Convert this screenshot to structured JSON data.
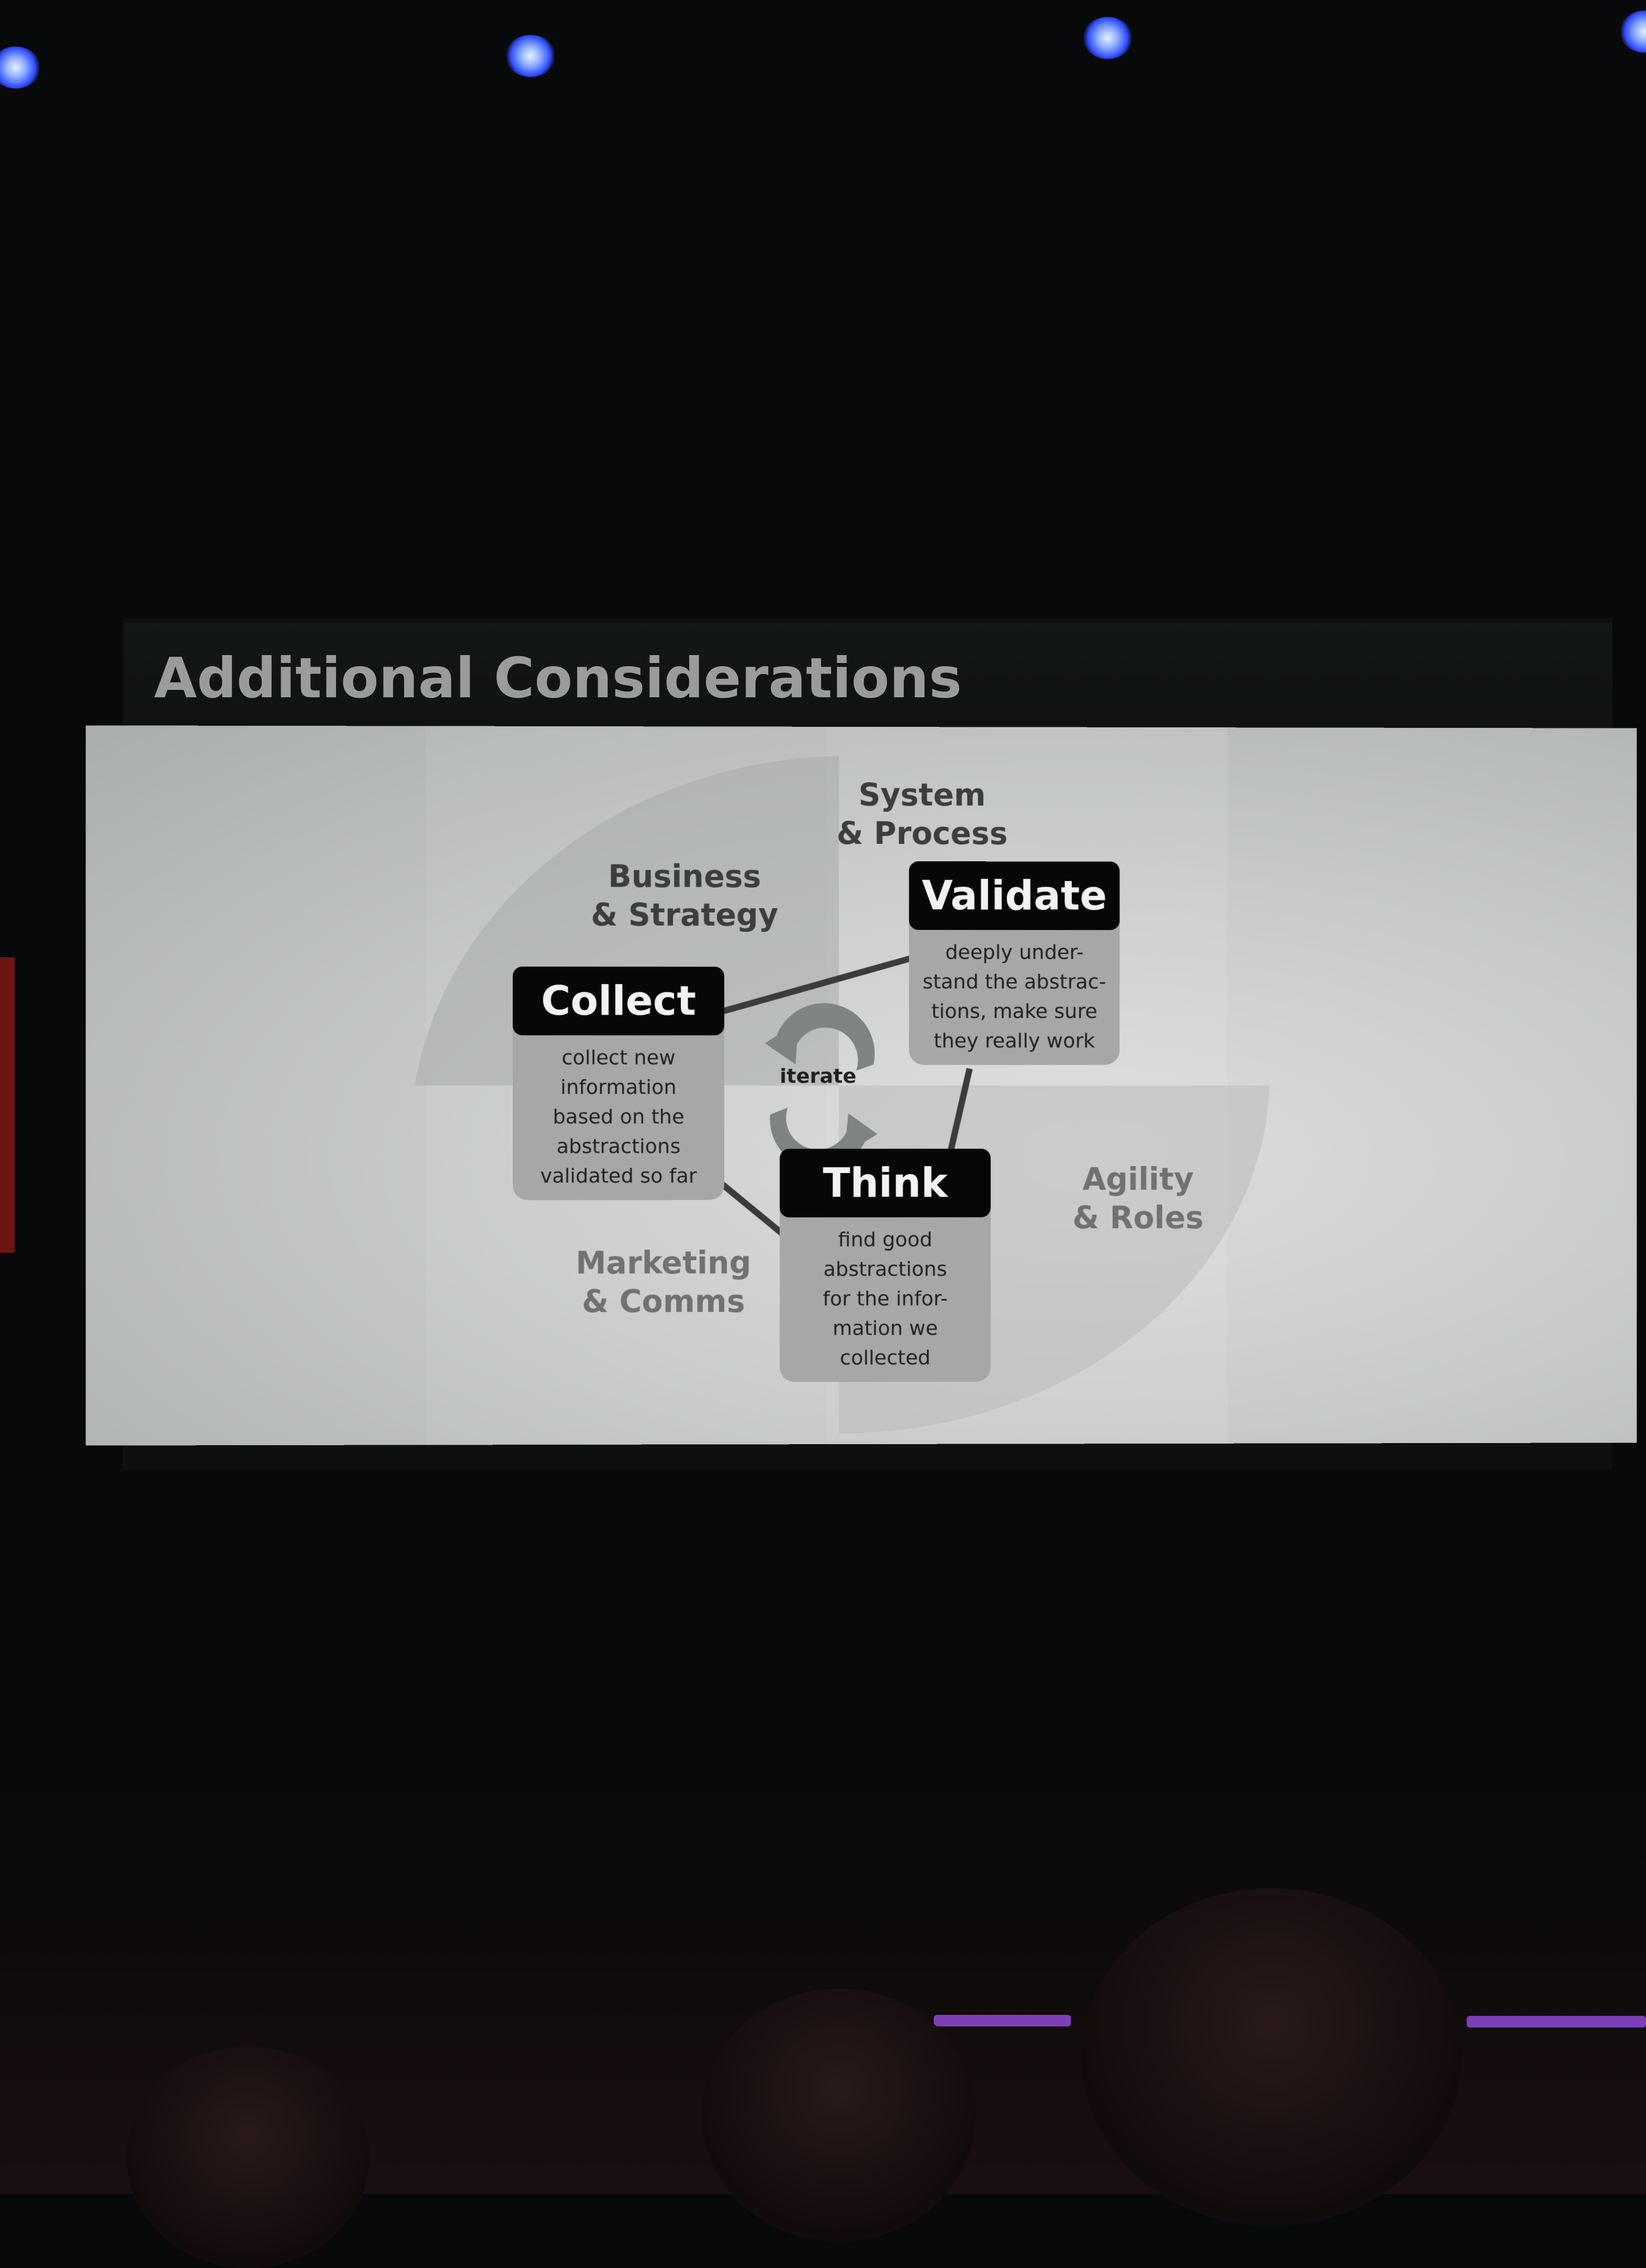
{
  "slide": {
    "title": "Additional Considerations",
    "quadrants": {
      "system_process": "System\n& Process",
      "business_strategy": "Business\n& Strategy",
      "agility_roles": "Agility\n& Roles",
      "marketing_comms": "Marketing\n& Comms"
    },
    "steps": {
      "validate": {
        "title": "Validate",
        "description": "deeply under-\nstand the abstrac-\ntions, make sure\nthey really work"
      },
      "collect": {
        "title": "Collect",
        "description": "collect new\ninformation\nbased on the\nabstractions\nvalidated so far"
      },
      "think": {
        "title": "Think",
        "description": "find good\nabstractions\nfor the infor-\nmation we\ncollected"
      }
    },
    "cycle_label": "iterate"
  },
  "colors": {
    "slide_background": "#c7cac8",
    "step_header": "#070707",
    "step_body": "#a5a8a6",
    "stage_light": "#3f5cff",
    "stage_strip": "#7c3fb7"
  }
}
